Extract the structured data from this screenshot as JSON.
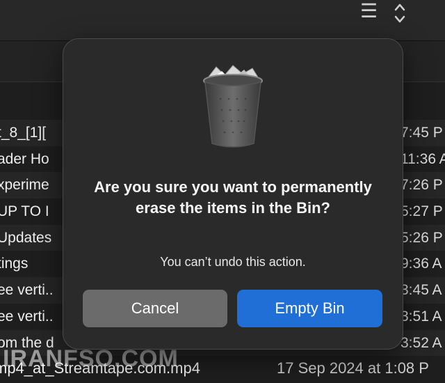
{
  "toolbar": {
    "list_view_icon": "list-view-icon",
    "sort_icon": "chevron-up-down-icon"
  },
  "file_list": {
    "rows": [
      {
        "name": "t_8_[1][",
        "date": "7:45 P"
      },
      {
        "name": "ader Ho",
        "date": "11:36 A"
      },
      {
        "name": "xperime",
        "date": "7:26 P"
      },
      {
        "name": "UP TO I",
        "date": "5:27 P"
      },
      {
        "name": "Updates",
        "date": "5:26 P"
      },
      {
        "name": "tings",
        "date": "9:36 A"
      },
      {
        "name": "ee verti..",
        "date": "3:45 A"
      },
      {
        "name": "ee verti..",
        "date": "3:51 A"
      },
      {
        "name": "om the d",
        "date": "3:52 A"
      }
    ],
    "last_row": {
      "name": "mp4_at_Streamtape.com.mp4",
      "date": "17 Sep 2024 at 1:08 P"
    }
  },
  "watermark": "IRANFSO.COM",
  "dialog": {
    "icon": "trash-bin-icon",
    "title": "Are you sure you want to permanently erase the items in the Bin?",
    "message": "You can’t undo this action.",
    "cancel_label": "Cancel",
    "confirm_label": "Empty Bin",
    "colors": {
      "confirm": "#1f6fd6",
      "cancel": "#6b6b6b",
      "background": "#2a2a2a"
    }
  }
}
